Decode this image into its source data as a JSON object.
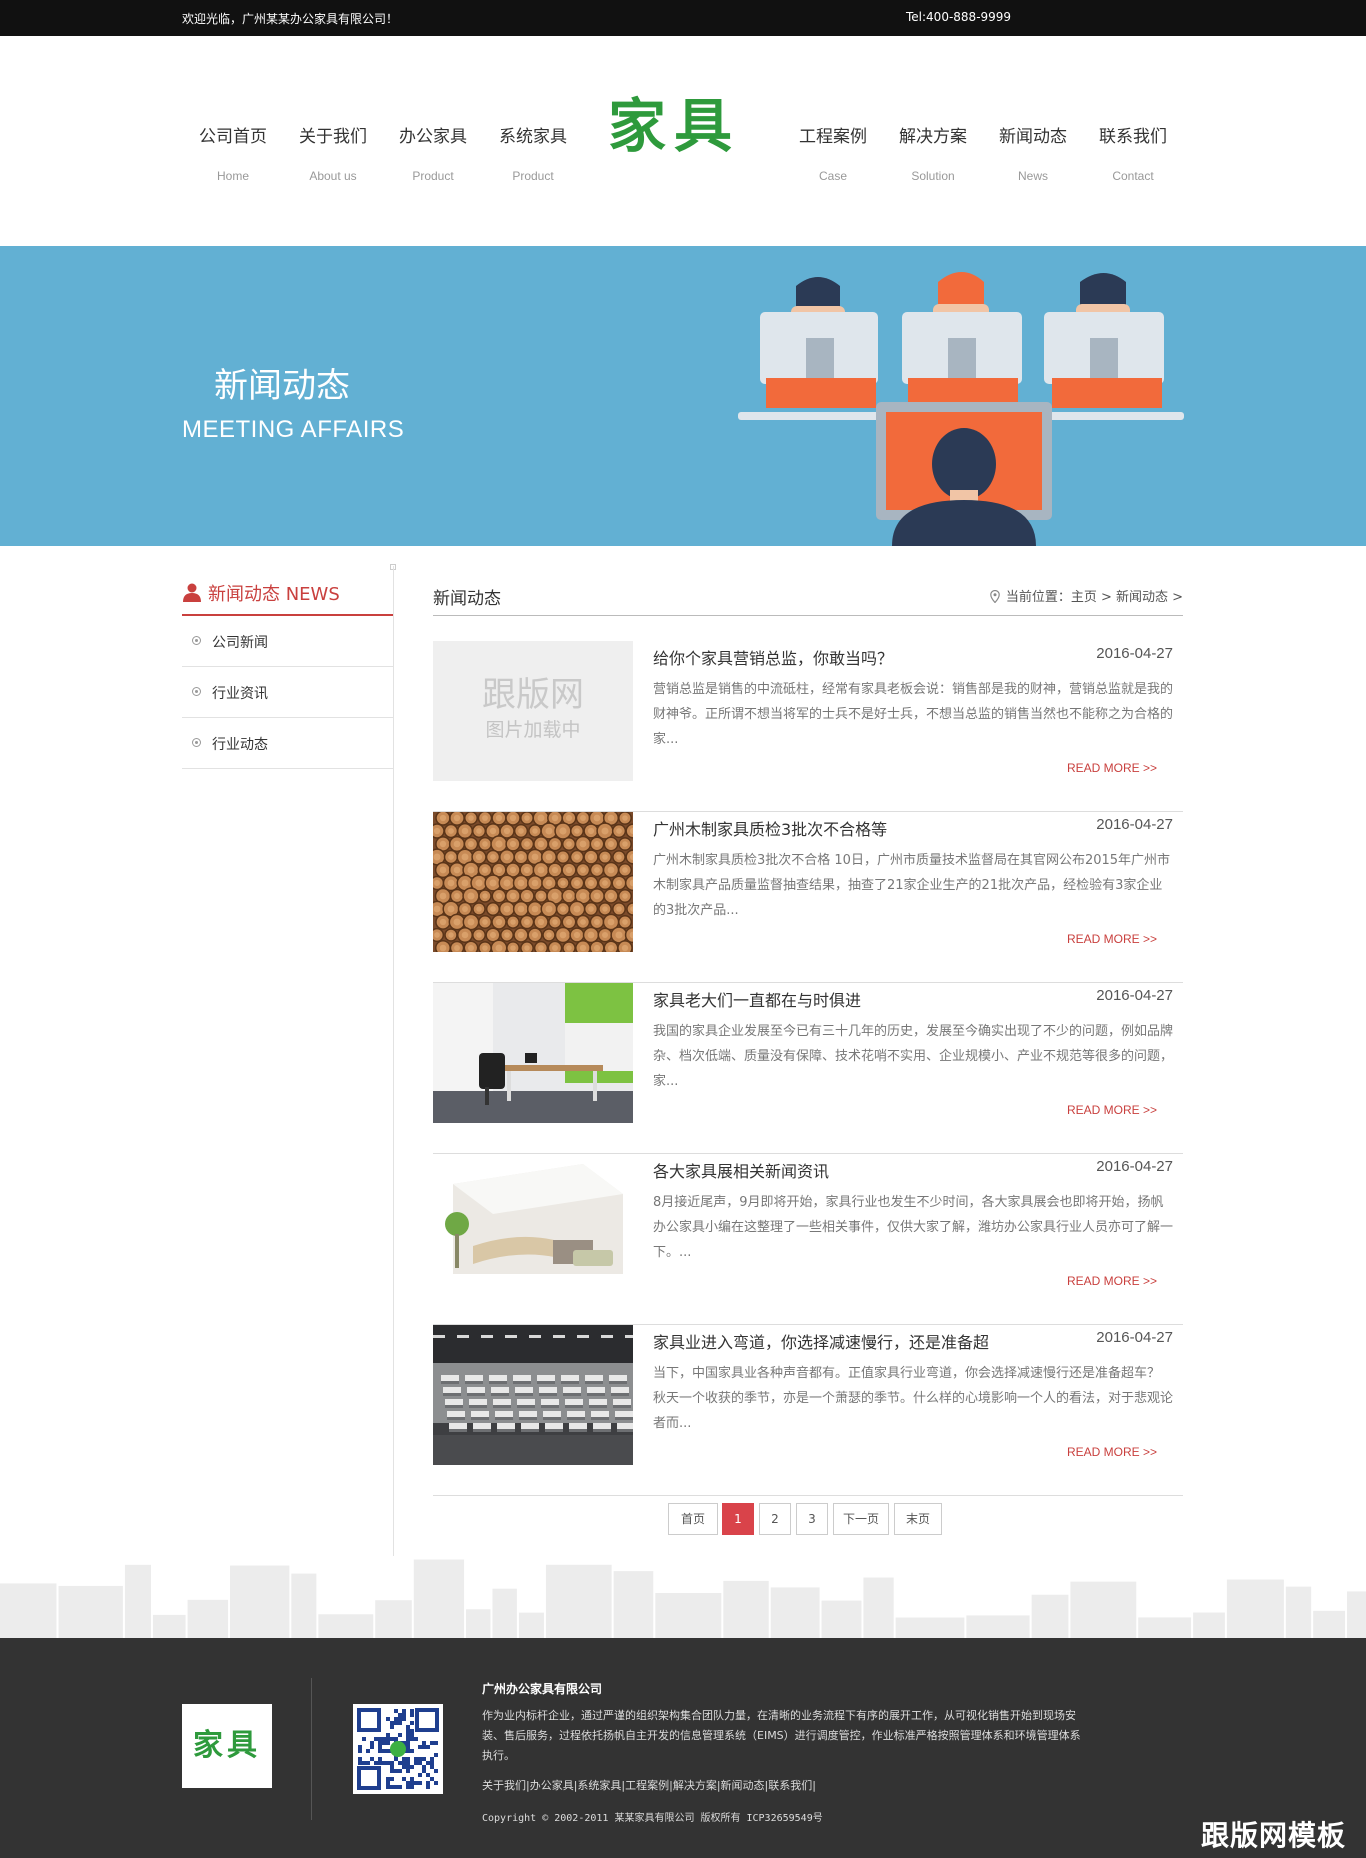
{
  "topbar": {
    "welcome": "欢迎光临，广州某某办公家具有限公司！",
    "tel": "Tel:400-888-9999"
  },
  "nav": {
    "logo": "家具",
    "items": [
      {
        "cn": "公司首页",
        "en": "Home"
      },
      {
        "cn": "关于我们",
        "en": "About us"
      },
      {
        "cn": "办公家具",
        "en": "Product"
      },
      {
        "cn": "系统家具",
        "en": "Product"
      },
      {
        "cn": "工程案例",
        "en": "Case"
      },
      {
        "cn": "解决方案",
        "en": "Solution"
      },
      {
        "cn": "新闻动态",
        "en": "News"
      },
      {
        "cn": "联系我们",
        "en": "Contact"
      }
    ]
  },
  "banner": {
    "title_cn": "新闻动态",
    "title_en": "MEETING AFFAIRS",
    "bg_color": "#62b0d3",
    "accent_color": "#f26a3b"
  },
  "sidebar": {
    "title": "新闻动态 NEWS",
    "items": [
      "公司新闻",
      "行业资讯",
      "行业动态"
    ]
  },
  "main": {
    "title": "新闻动态",
    "breadcrumb": "当前位置：主页 > 新闻动态 >",
    "read_more": "READ MORE >>",
    "placeholder_brand": "跟版网",
    "placeholder_text": "图片加载中",
    "news": [
      {
        "title": "给你个家具营销总监，你敢当吗？",
        "date": "2016-04-27",
        "desc": "营销总监是销售的中流砥柱，经常有家具老板会说：销售部是我的财神，营销总监就是我的财神爷。正所谓不想当将军的士兵不是好士兵，不想当总监的销售当然也不能称之为合格的家...",
        "image": "placeholder"
      },
      {
        "title": "广州木制家具质检3批次不合格等",
        "date": "2016-04-27",
        "desc": "广州木制家具质检3批次不合格 10日，广州市质量技术监督局在其官网公布2015年广州市木制家具产品质量监督抽查结果，抽查了21家企业生产的21批次产品，经检验有3家企业的3批次产品...",
        "image": "logs"
      },
      {
        "title": "家具老大们一直都在与时俱进",
        "date": "2016-04-27",
        "desc": "我国的家具企业发展至今已有三十几年的历史，发展至今确实出现了不少的问题，例如品牌杂、档次低端、质量没有保障、技术花哨不实用、企业规模小、产业不规范等很多的问题，家...",
        "image": "office"
      },
      {
        "title": "各大家具展相关新闻资讯",
        "date": "2016-04-27",
        "desc": "8月接近尾声，9月即将开始，家具行业也发生不少时间，各大家具展会也即将开始，扬帆办公家具小编在这整理了一些相关事件，仅供大家了解，潍坊办公家具行业人员亦可了解一下。...",
        "image": "reception"
      },
      {
        "title": "家具业进入弯道，你选择减速慢行，还是准备超",
        "date": "2016-04-27",
        "desc": "当下，中国家具业各种声音都有。正值家具行业弯道，你会选择减速慢行还是准备超车？ 秋天一个收获的季节，亦是一个萧瑟的季节。什么样的心境影响一个人的看法，对于悲观论者而...",
        "image": "cubicles"
      }
    ]
  },
  "pagination": {
    "first": "首页",
    "pages": [
      "1",
      "2",
      "3"
    ],
    "current": "1",
    "next": "下一页",
    "last": "末页"
  },
  "footer": {
    "logo": "家具",
    "company": "广州办公家具有限公司",
    "desc": "作为业内标杆企业，通过严谨的组织架构集合团队力量，在清晰的业务流程下有序的展开工作，从可视化销售开始到现场安装、售后服务，过程依托扬帆自主开发的信息管理系统（EIMS）进行调度管控，作业标准严格按照管理体系和环境管理体系执行。",
    "links": "关于我们|办公家具|系统家具|工程案例|解决方案|新闻动态|联系我们|",
    "copyright": "Copyright © 2002-2011 某某家具有限公司 版权所有 ICP32659549号",
    "watermark": "跟版网模板"
  }
}
